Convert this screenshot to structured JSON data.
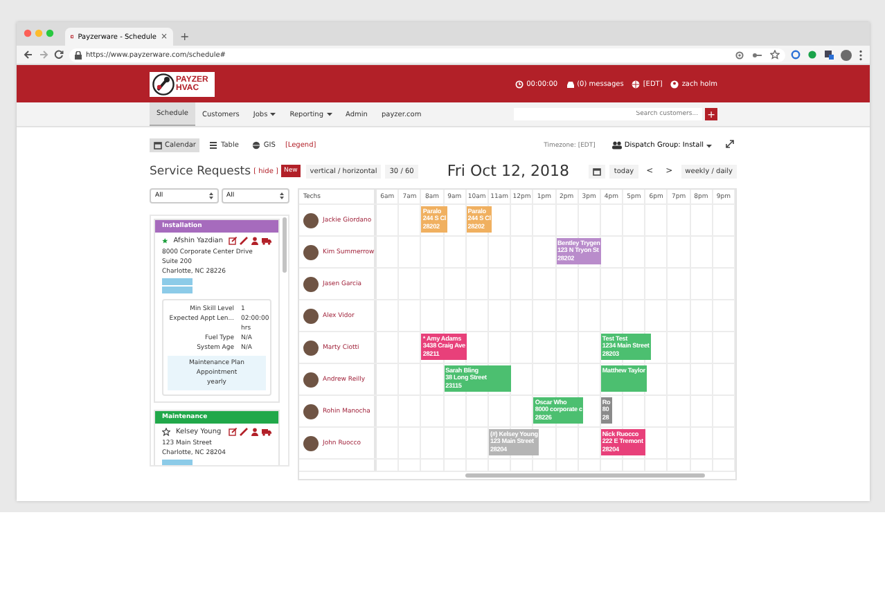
{
  "browser": {
    "tab_title": "Payzerware - Schedule",
    "tab_close": "×",
    "new_tab": "+",
    "url": "https://www.payzerware.com/schedule#"
  },
  "header": {
    "logo": "PAYZER HVAC",
    "timer": "00:00:00",
    "messages": "(0) messages",
    "timezone": "[EDT]",
    "user": "zach holm"
  },
  "nav": {
    "items": [
      {
        "label": "Schedule",
        "selected": true,
        "dropdown": false
      },
      {
        "label": "Customers",
        "selected": false,
        "dropdown": false
      },
      {
        "label": "Jobs",
        "selected": false,
        "dropdown": true
      },
      {
        "label": "Reporting",
        "selected": false,
        "dropdown": true
      },
      {
        "label": "Admin",
        "selected": false,
        "dropdown": false
      },
      {
        "label": "payzer.com",
        "selected": false,
        "dropdown": false
      }
    ],
    "search": {
      "placeholder": "Search customers..."
    },
    "add": "+"
  },
  "views": [
    {
      "label": "Calendar",
      "selected": true
    },
    {
      "label": "Table",
      "selected": false
    },
    {
      "label": "GIS",
      "selected": false
    }
  ],
  "legend": "[Legend]",
  "timezone": "Timezone: [EDT]",
  "dispatch_group": "Dispatch Group: Install",
  "service_requests": {
    "title": "Service Requests",
    "hide": "[ hide ]",
    "new": "New",
    "filters": [
      "All",
      "All"
    ],
    "cards": [
      {
        "category": "Installation",
        "color": "#a66bbd",
        "starred": true,
        "name": "Afshin Yazdian",
        "address": [
          "8000 Corporate Center Drive",
          "Suite 200",
          "Charlotte, NC 28226"
        ],
        "tags": [
          {
            "kind": "tag"
          },
          {
            "kind": "tag"
          }
        ],
        "details": [
          {
            "label": "Min Skill Level",
            "value": "1"
          },
          {
            "label": "Expected Appt Len...",
            "value": "02:00:00 hrs"
          },
          {
            "label": "Fuel Type",
            "value": "N/A"
          },
          {
            "label": "System Age",
            "value": "N/A"
          }
        ],
        "note": [
          "Maintenance Plan Appointment",
          "yearly"
        ]
      },
      {
        "category": "Maintenance",
        "color": "#21a84a",
        "starred": false,
        "name": "Kelsey Young",
        "address": [
          "123 Main Street",
          "Charlotte, NC 28204"
        ],
        "tags": [
          {
            "kind": "tag"
          }
        ]
      }
    ]
  },
  "controls": {
    "orientation": "vertical / horizontal",
    "interval": "30 / 60",
    "date": "Fri Oct 12, 2018",
    "today": "today",
    "prev": "<",
    "next": ">",
    "range": "weekly / daily"
  },
  "calendar": {
    "techs_header": "Techs",
    "hours": [
      "6am",
      "7am",
      "8am",
      "9am",
      "10am",
      "11am",
      "12pm",
      "1pm",
      "2pm",
      "3pm",
      "4pm",
      "5pm",
      "6pm",
      "7pm",
      "8pm",
      "9pm"
    ],
    "techs": [
      {
        "name": "Jackie Giordano",
        "slots": [
          {
            "kind": "empty"
          },
          {
            "kind": "empty"
          },
          {
            "kind": "start",
            "color": "#f0b060",
            "lines": [
              "Paralo",
              "244 S Cl",
              "28202"
            ]
          },
          {
            "kind": "empty"
          },
          {
            "kind": "start",
            "color": "#f0b060",
            "lines": [
              "Paralo",
              "244 S Cl",
              "28202"
            ]
          }
        ]
      },
      {
        "name": "Kim Summerrow",
        "slots": [
          {
            "kind": "empty"
          },
          {
            "kind": "empty"
          },
          {
            "kind": "empty"
          },
          {
            "kind": "empty"
          },
          {
            "kind": "empty"
          },
          {
            "kind": "empty"
          },
          {
            "kind": "empty"
          },
          {
            "kind": "empty"
          },
          {
            "kind": "start",
            "color": "#b98ccb",
            "lines": [
              "Bentley Trygen",
              "123 N Tryon St",
              "28202"
            ]
          },
          {
            "kind": "continue"
          }
        ]
      },
      {
        "name": "Jasen Garcia"
      },
      {
        "name": "Alex Vidor"
      },
      {
        "name": "Marty Ciotti",
        "slots": [
          {
            "kind": "empty"
          },
          {
            "kind": "empty"
          },
          {
            "kind": "start",
            "color": "#e8407a",
            "lines": [
              "* Amy Adams",
              "3438 Craig Ave",
              "28211"
            ]
          },
          {
            "kind": "continue"
          },
          {
            "kind": "empty"
          },
          {
            "kind": "empty"
          },
          {
            "kind": "empty"
          },
          {
            "kind": "empty"
          },
          {
            "kind": "empty"
          },
          {
            "kind": "empty"
          },
          {
            "kind": "start",
            "color": "#4cbf70",
            "lines": [
              "Test Test",
              "1234 Main Street",
              "28203"
            ]
          },
          {
            "kind": "continue"
          }
        ]
      },
      {
        "name": "Andrew Reilly",
        "slots": [
          {
            "kind": "empty"
          },
          {
            "kind": "empty"
          },
          {
            "kind": "empty"
          },
          {
            "kind": "start",
            "color": "#4cbf70",
            "lines": [
              "Sarah Bling",
              "38 Long Street",
              "23115"
            ]
          },
          {
            "kind": "continue"
          },
          {
            "kind": "continue"
          },
          {
            "kind": "empty"
          },
          {
            "kind": "empty"
          },
          {
            "kind": "empty"
          },
          {
            "kind": "empty"
          },
          {
            "kind": "start",
            "color": "#4cbf70",
            "lines": [
              "Matthew Taylor"
            ]
          },
          {
            "kind": "continue"
          }
        ]
      },
      {
        "name": "Rohin Manocha",
        "slots": [
          {
            "kind": "empty"
          },
          {
            "kind": "empty"
          },
          {
            "kind": "empty"
          },
          {
            "kind": "empty"
          },
          {
            "kind": "empty"
          },
          {
            "kind": "empty"
          },
          {
            "kind": "empty"
          },
          {
            "kind": "start",
            "color": "#4cbf70",
            "lines": [
              "Oscar Who",
              "8000 corporate c",
              "28226"
            ]
          },
          {
            "kind": "continue"
          },
          {
            "kind": "empty"
          },
          {
            "kind": "half",
            "color": "#8a8a8a",
            "lines": [
              "Ro",
              "80",
              "28"
            ]
          }
        ]
      },
      {
        "name": "John Ruocco",
        "slots": [
          {
            "kind": "empty"
          },
          {
            "kind": "empty"
          },
          {
            "kind": "empty"
          },
          {
            "kind": "empty"
          },
          {
            "kind": "empty"
          },
          {
            "kind": "start",
            "color": "#b5b5b5",
            "lines": [
              "(#) Kelsey Young",
              "123 Main Street",
              "28204"
            ]
          },
          {
            "kind": "continue"
          },
          {
            "kind": "empty"
          },
          {
            "kind": "empty"
          },
          {
            "kind": "empty"
          },
          {
            "kind": "start",
            "color": "#e8407a",
            "lines": [
              "Nick Ruocco",
              "222 E Tremont",
              "28204"
            ]
          },
          {
            "kind": "continue"
          }
        ]
      }
    ]
  }
}
